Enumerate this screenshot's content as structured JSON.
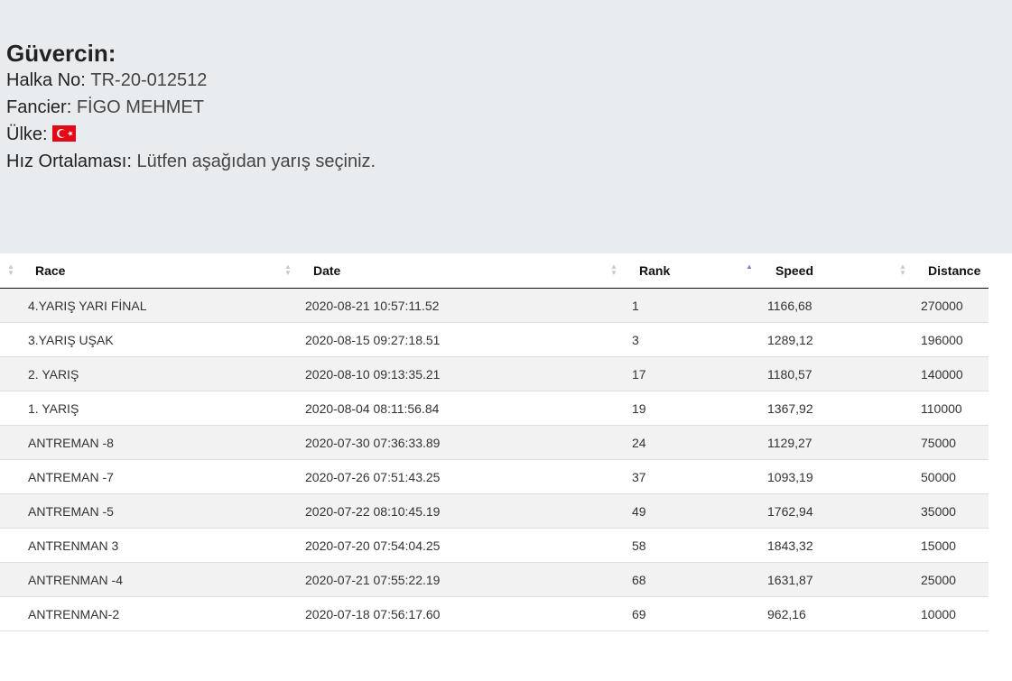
{
  "pigeon": {
    "title": "Güvercin:",
    "ring_label": "Halka No:",
    "ring_value": "TR-20-012512",
    "fancier_label": "Fancier:",
    "fancier_value": "FİGO MEHMET",
    "country_label": "Ülke:",
    "country_flag": "turkey-flag-icon",
    "speed_label": "Hız Ortalaması:",
    "speed_value": "Lütfen aşağıdan yarış seçiniz."
  },
  "table": {
    "headers": [
      "Race",
      "Date",
      "Rank",
      "Speed",
      "Distance"
    ],
    "rows": [
      [
        "4.YARIŞ YARI FİNAL",
        "2020-08-21 10:57:11.52",
        "1",
        "1166,68",
        "270000"
      ],
      [
        "3.YARIŞ UŞAK",
        "2020-08-15 09:27:18.51",
        "3",
        "1289,12",
        "196000"
      ],
      [
        "2. YARIŞ",
        "2020-08-10 09:13:35.21",
        "17",
        "1180,57",
        "140000"
      ],
      [
        "1. YARIŞ",
        "2020-08-04 08:11:56.84",
        "19",
        "1367,92",
        "110000"
      ],
      [
        "ANTREMAN -8",
        "2020-07-30 07:36:33.89",
        "24",
        "1129,27",
        "75000"
      ],
      [
        "ANTREMAN -7",
        "2020-07-26 07:51:43.25",
        "37",
        "1093,19",
        "50000"
      ],
      [
        "ANTREMAN -5",
        "2020-07-22 08:10:45.19",
        "49",
        "1762,94",
        "35000"
      ],
      [
        "ANTRENMAN 3",
        "2020-07-20 07:54:04.25",
        "58",
        "1843,32",
        "15000"
      ],
      [
        "ANTRENMAN -4",
        "2020-07-21 07:55:22.19",
        "68",
        "1631,87",
        "25000"
      ],
      [
        "ANTRENMAN-2",
        "2020-07-18 07:56:17.60",
        "69",
        "962,16",
        "10000"
      ]
    ],
    "sorted_column": "Rank",
    "sort_direction": "ascending"
  }
}
